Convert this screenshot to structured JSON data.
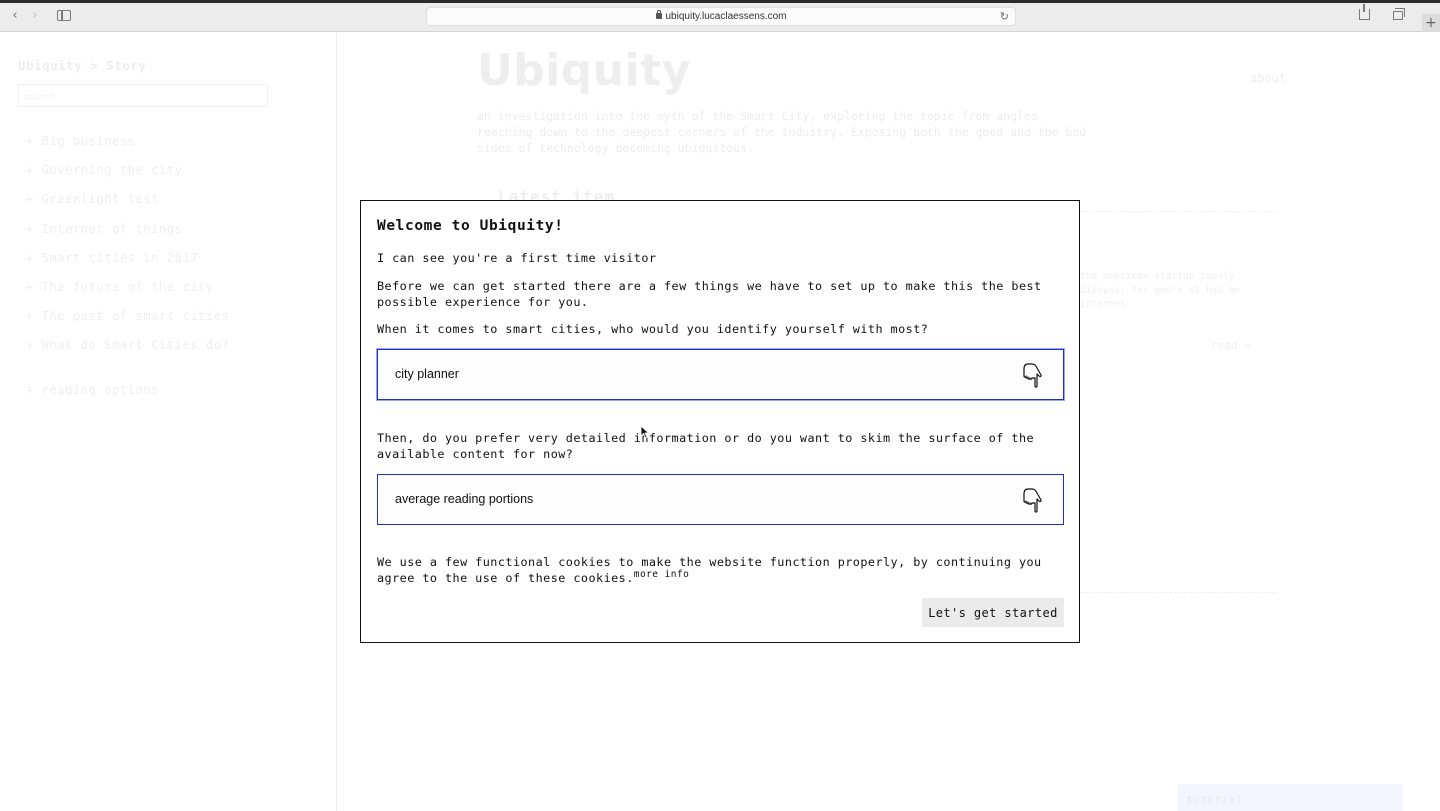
{
  "browser": {
    "url": "ubiquity.lucaclaessens.com"
  },
  "sidebar": {
    "breadcrumb": "Ubiquity > Story",
    "search_placeholder": "search",
    "items": [
      {
        "label": "+ Big business"
      },
      {
        "label": "+ Governing the city"
      },
      {
        "label": "+ Greenlight test"
      },
      {
        "label": "+ Internet of things"
      },
      {
        "label": "+ Smart cities in 2017"
      },
      {
        "label": "+ The future of the city"
      },
      {
        "label": "+ The past of smart cities"
      },
      {
        "label": "+ What do Smart Cities do?"
      }
    ],
    "reading_options": "+ reading options"
  },
  "main": {
    "title": "Ubiquity",
    "about": "about",
    "intro": "an investigation into the myth of the Smart City, exploring the topic from angles reaching down to the deepest corners of the industry. Exposing both the good and the bad sides of technology becoming ubiquitous.",
    "latest_heading": "Latest item",
    "excerpt": "the american startup iously discuss, for god's st had an internet",
    "read_link": "read →",
    "tutorial": "tutorial",
    "tutorial_close": "x"
  },
  "modal": {
    "title": "Welcome to Ubiquity!",
    "first_visit": "I can see you're a first time visitor",
    "setup_text": "Before we can get started there are a few things we have to set up to make this the best possible experience for you.",
    "identity_question": "When it comes to smart cities, who would you identify yourself with most?",
    "identity_value": "city planner",
    "detail_question": "Then, do you prefer very detailed information or do you want to skim the surface of the available content for now?",
    "detail_value": "average reading portions",
    "cookie_text": "We use a few functional cookies to make the website function properly, by continuing you agree to the use of these cookies.",
    "more_info": "more info",
    "start_button": "Let's get started"
  },
  "colors": {
    "accent": "#1f30c9",
    "button_bg": "#ebebeb",
    "faded_text": "#eeeeee"
  },
  "icons": [
    "chevron-left-icon",
    "chevron-right-icon",
    "sidebar-icon",
    "lock-icon",
    "reload-icon",
    "share-icon",
    "tabs-icon",
    "plus-icon",
    "pointing-hand-icon"
  ]
}
